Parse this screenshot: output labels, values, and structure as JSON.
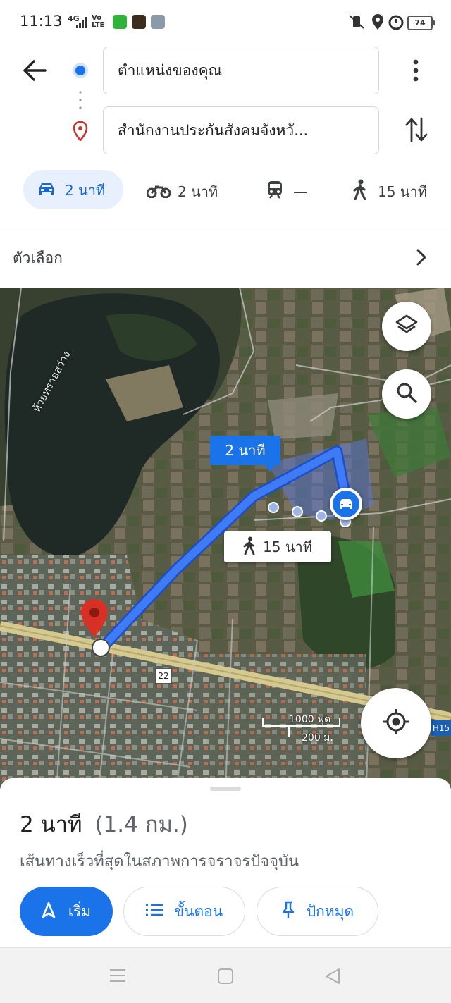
{
  "status_bar": {
    "time": "11:13",
    "network": "4G",
    "volte": "Vo LTE",
    "battery": "74"
  },
  "header": {
    "origin": "ตำแหน่งของคุณ",
    "destination": "สำนักงานประกันสังคมจังหวั..."
  },
  "modes": [
    {
      "icon": "car-icon",
      "label": "2 นาที",
      "active": true
    },
    {
      "icon": "motorcycle-icon",
      "label": "2 นาที"
    },
    {
      "icon": "train-icon",
      "label": "—"
    },
    {
      "icon": "walk-icon",
      "label": "15 นาที"
    }
  ],
  "options": {
    "label": "ตัวเลือก"
  },
  "map": {
    "water_label": "ห้วยทรายสว่าง",
    "route_label": "2 นาที",
    "walk_label": "15 นาที",
    "road_number": "22",
    "road_number_2": "H15",
    "scale_ft": "1000 ฟุต",
    "scale_m": "200 ม.",
    "colors": {
      "route": "#3e7bf4",
      "destination_pin": "#d93025"
    }
  },
  "sheet": {
    "duration": "2 นาที",
    "distance": "(1.4 กม.)",
    "subtitle": "เส้นทางเร็วที่สุดในสภาพการจราจรปัจจุบัน",
    "buttons": {
      "start": "เริ่ม",
      "steps": "ขั้นตอน",
      "pin": "ปักหมุด"
    }
  }
}
